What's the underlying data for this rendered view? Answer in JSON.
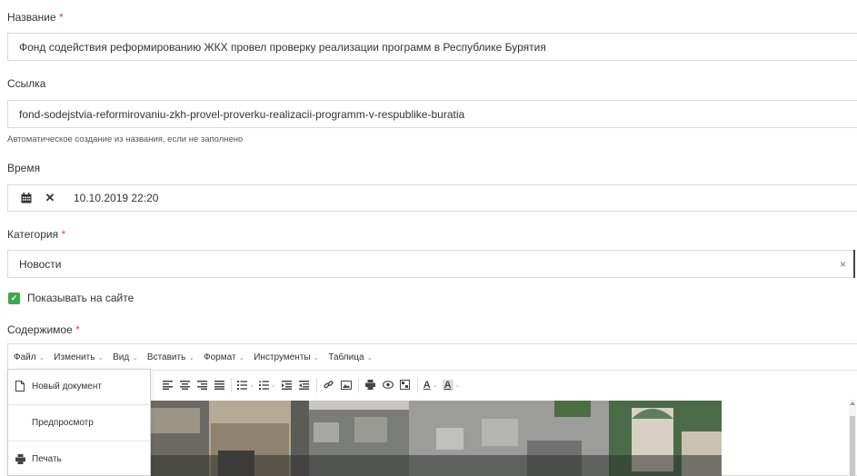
{
  "fields": {
    "title": {
      "label": "Название",
      "required_mark": "*",
      "value": "Фонд содействия реформированию ЖКХ провел проверку реализации программ в Республике Бурятия"
    },
    "link": {
      "label": "Ссылка",
      "value": "fond-sodejstvia-reformirovaniu-zkh-provel-proverku-realizacii-programm-v-respublike-buratia",
      "hint": "Автоматическое создание из названия, если не заполнено"
    },
    "time": {
      "label": "Время",
      "value": "10.10.2019 22:20",
      "calendar_icon": "calendar-icon",
      "clear_icon": "close-icon",
      "clear_glyph": "✕"
    },
    "category": {
      "label": "Категория",
      "required_mark": "*",
      "value": "Новости",
      "clear_glyph": "×"
    },
    "show_on_site": {
      "label": "Показывать на сайте",
      "checked": true,
      "check_glyph": "✓"
    },
    "content": {
      "label": "Содержимое",
      "required_mark": "*"
    }
  },
  "editor": {
    "menu": [
      {
        "label": "Файл"
      },
      {
        "label": "Изменить"
      },
      {
        "label": "Вид"
      },
      {
        "label": "Вставить"
      },
      {
        "label": "Формат"
      },
      {
        "label": "Инструменты"
      },
      {
        "label": "Таблица"
      }
    ],
    "caret": "⌄",
    "file_menu": {
      "new_document": "Новый документ",
      "preview": "Предпросмотр",
      "print": "Печать"
    },
    "toolbar_text": {
      "text_color_glyph": "A",
      "bg_color_glyph": "A"
    }
  },
  "colors": {
    "required": "#e04848",
    "checkbox": "#3ea74b",
    "border": "#d9d9d9"
  }
}
